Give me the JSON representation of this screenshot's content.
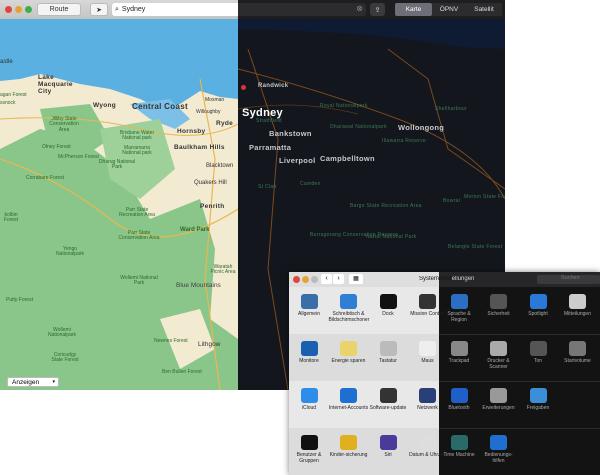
{
  "maps": {
    "toolbar": {
      "route_label": "Route",
      "search_value": "Sydney",
      "tabs": [
        "Karte",
        "ÖPNV",
        "Satellit"
      ],
      "active_tab": "Karte"
    },
    "show_menu": {
      "value": "Anzeigen"
    },
    "light_labels": [
      "astle",
      "Lake Macquarie City",
      "Wyong",
      "Central Coast",
      "Hornsby",
      "Ryde",
      "Baulkham Hills",
      "Blacktown",
      "Quakers Hill",
      "Penrith",
      "Jilliby State Conservation Area",
      "Olney Forest",
      "McPherson Forest",
      "Corrabare Forest",
      "Brisbane Water National park",
      "Marramarra National park",
      "Dharug National Park",
      "Parr State Recreation Area",
      "Parr State Conservation Area",
      "Ward Park",
      "Yengo Nationalpark",
      "Wollemi National Park",
      "Wollemi Nationalpark",
      "Putty Forest",
      "Coricudgy State Forest",
      "Newnes Forest",
      "Lithgow",
      "Blue Mountains",
      "Waratah Picnic Area",
      "Ben Bullen Forest",
      "Mosman",
      "Willoughby",
      "ssnock",
      "agan Forest",
      "kolbin Forest"
    ],
    "dark_labels": [
      "Randwick",
      "Sydney",
      "Strathfield",
      "Bankstown",
      "Parramatta",
      "Liverpool",
      "Campbelltown",
      "Wollongong",
      "Shellharbour",
      "Royal Nationalpark",
      "Dharawal Nationalpark",
      "Illawarra Reserve",
      "St Clair",
      "Camden",
      "Bargo State Recreation Area",
      "Nattai National Park",
      "Burragorang Conservation Reserve",
      "Bowral",
      "Belanglo State Forest",
      "Morton State Forest"
    ]
  },
  "prefs": {
    "title": "Systemeinstellungen",
    "search_placeholder": "Suchen",
    "rows": [
      [
        {
          "label": "Allgemein",
          "icon": "general-icon",
          "color": "#3a6ea8"
        },
        {
          "label": "Schreibtisch & Bildschirmschoner",
          "icon": "desktop-icon",
          "color": "#2f7fd6"
        },
        {
          "label": "Dock",
          "icon": "dock-icon",
          "color": "#111"
        },
        {
          "label": "Mission Control",
          "icon": "mission-control-icon",
          "color": "#333"
        },
        {
          "label": "Sprache & Region",
          "icon": "flag-icon",
          "color": "#2a6fc4"
        },
        {
          "label": "Sicherheit",
          "icon": "house-lock-icon",
          "color": "#555"
        },
        {
          "label": "Spotlight",
          "icon": "magnifier-icon",
          "color": "#2a79d8"
        },
        {
          "label": "Mitteilungen",
          "icon": "notifications-icon",
          "color": "#ccc"
        }
      ],
      [
        {
          "label": "Monitore",
          "icon": "monitor-icon",
          "color": "#1a5fb0"
        },
        {
          "label": "Energie sparen",
          "icon": "lightbulb-icon",
          "color": "#e8d46a"
        },
        {
          "label": "Tastatur",
          "icon": "keyboard-icon",
          "color": "#bbb"
        },
        {
          "label": "Maus",
          "icon": "mouse-icon",
          "color": "#eee"
        },
        {
          "label": "Trackpad",
          "icon": "trackpad-icon",
          "color": "#888"
        },
        {
          "label": "Drucker & Scanner",
          "icon": "printer-icon",
          "color": "#aaa"
        },
        {
          "label": "Ton",
          "icon": "speaker-icon",
          "color": "#555"
        },
        {
          "label": "Startvolume",
          "icon": "disk-icon",
          "color": "#777"
        }
      ],
      [
        {
          "label": "iCloud",
          "icon": "cloud-icon",
          "color": "#2c8ee8"
        },
        {
          "label": "Internet-Accounts",
          "icon": "at-icon",
          "color": "#1f6fd0"
        },
        {
          "label": "Software-update",
          "icon": "gear-clock-icon",
          "color": "#333"
        },
        {
          "label": "Netzwerk",
          "icon": "globe-icon",
          "color": "#2a3f77"
        },
        {
          "label": "Bluetooth",
          "icon": "bluetooth-icon",
          "color": "#1f5fc8"
        },
        {
          "label": "Erweiterungen",
          "icon": "puzzle-icon",
          "color": "#999"
        },
        {
          "label": "Freigaben",
          "icon": "folder-icon",
          "color": "#3a8fd8"
        }
      ],
      [
        {
          "label": "Benutzer & Gruppen",
          "icon": "users-icon",
          "color": "#111"
        },
        {
          "label": "Kinder-sicherung",
          "icon": "parental-icon",
          "color": "#e0b020"
        },
        {
          "label": "Siri",
          "icon": "siri-icon",
          "color": "#4a3a9a"
        },
        {
          "label": "Datum & Uhrzeit",
          "icon": "clock-icon",
          "color": "#ddd"
        },
        {
          "label": "Time Machine",
          "icon": "time-machine-icon",
          "color": "#2a6a6a"
        },
        {
          "label": "Bedienungs-hilfen",
          "icon": "accessibility-icon",
          "color": "#1f6fd0"
        }
      ]
    ]
  }
}
